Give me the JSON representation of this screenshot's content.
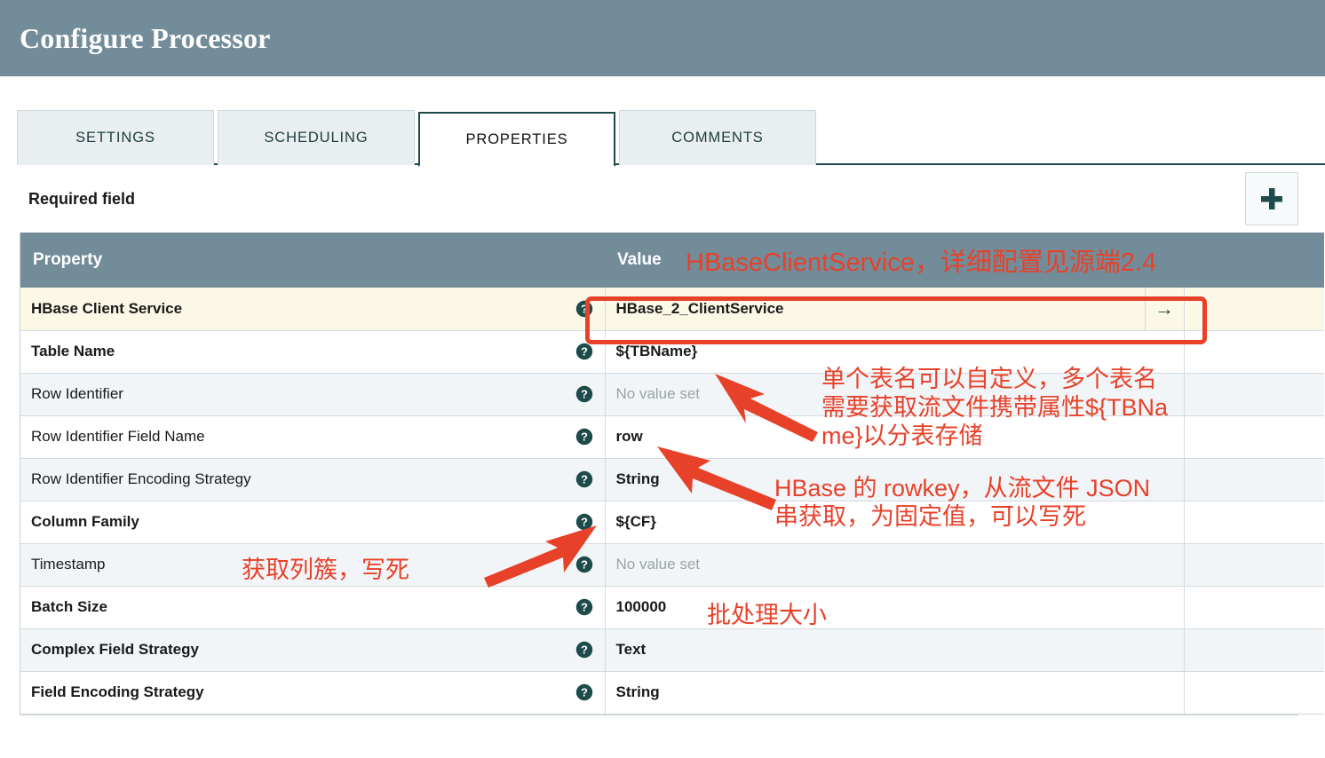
{
  "window": {
    "title": "Configure Processor"
  },
  "tabs": [
    {
      "label": "SETTINGS",
      "active": false
    },
    {
      "label": "SCHEDULING",
      "active": false
    },
    {
      "label": "PROPERTIES",
      "active": true
    },
    {
      "label": "COMMENTS",
      "active": false
    }
  ],
  "toolbar": {
    "required_field_label": "Required field",
    "add_property_icon": "plus-icon"
  },
  "table": {
    "columns": [
      "Property",
      "Value"
    ],
    "help_icon": "question-mark-circle-icon",
    "goto_icon": "arrow-right-icon",
    "rows": [
      {
        "property": "HBase Client Service",
        "required": true,
        "value": "HBase_2_ClientService",
        "empty": false,
        "highlight": true,
        "has_goto": true
      },
      {
        "property": "Table Name",
        "required": true,
        "value": "${TBName}",
        "empty": false,
        "highlight": false,
        "has_goto": false
      },
      {
        "property": "Row Identifier",
        "required": false,
        "value": "No value set",
        "empty": true,
        "highlight": false,
        "has_goto": false
      },
      {
        "property": "Row Identifier Field Name",
        "required": false,
        "value": "row",
        "empty": false,
        "highlight": false,
        "has_goto": false
      },
      {
        "property": "Row Identifier Encoding Strategy",
        "required": false,
        "value": "String",
        "empty": false,
        "highlight": false,
        "has_goto": false
      },
      {
        "property": "Column Family",
        "required": true,
        "value": "${CF}",
        "empty": false,
        "highlight": false,
        "has_goto": false
      },
      {
        "property": "Timestamp",
        "required": false,
        "value": "No value set",
        "empty": true,
        "highlight": false,
        "has_goto": false
      },
      {
        "property": "Batch Size",
        "required": true,
        "value": "100000",
        "empty": false,
        "highlight": false,
        "has_goto": false
      },
      {
        "property": "Complex Field Strategy",
        "required": true,
        "value": "Text",
        "empty": false,
        "highlight": false,
        "has_goto": false
      },
      {
        "property": "Field Encoding Strategy",
        "required": true,
        "value": "String",
        "empty": false,
        "highlight": false,
        "has_goto": false
      }
    ]
  },
  "annotations": {
    "client_service": "HBaseClientService，详细配置见源端2.4",
    "table_name": "单个表名可以自定义，多个表名\n需要获取流文件携带属性${TBNa\nme}以分表存储",
    "rowkey": "HBase 的 rowkey，从流文件 JSON\n串获取，为固定值，可以写死",
    "column_family": "获取列簇，写死",
    "batch_size": "批处理大小"
  },
  "colors": {
    "header_bar": "#728c99",
    "accent_teal": "#1d4a4a",
    "annotation_red": "#e8412a",
    "highlight_row": "#fcf8e6",
    "stripe_row": "#f2f5f7"
  }
}
